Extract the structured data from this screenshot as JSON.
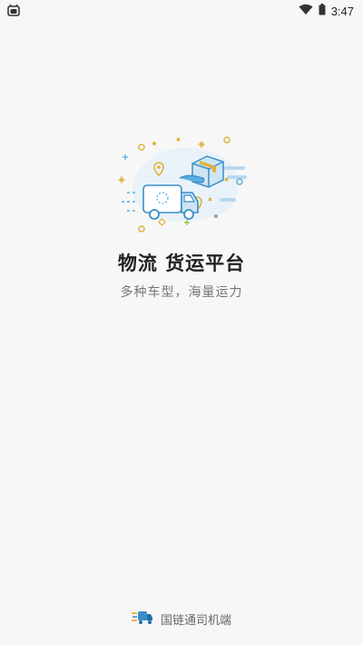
{
  "status_bar": {
    "time": "3:47",
    "left_icon": "android-icon",
    "wifi_icon": "wifi-icon",
    "battery_icon": "battery-icon"
  },
  "splash": {
    "illustration_icon": "delivery-truck-illustration",
    "headline": "物流  货运平台",
    "subheadline": "多种车型，海量运力"
  },
  "footer": {
    "logo_icon": "fast-truck-logo-icon",
    "app_name": "国链通司机端"
  },
  "colors": {
    "background": "#f7f7f7",
    "headline": "#222222",
    "subheadline": "#777777",
    "illustration_blue": "#5aaee0",
    "illustration_gold": "#e0b23a"
  }
}
